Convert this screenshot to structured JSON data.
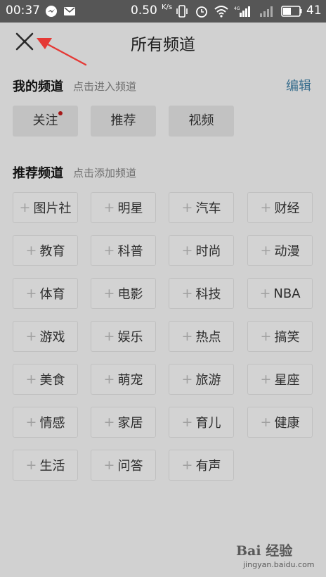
{
  "status_bar": {
    "time": "00:37",
    "network_speed": "0.50",
    "speed_unit": "K/s",
    "battery": "41",
    "icons": [
      "messenger-icon",
      "mail-icon",
      "vibrate-icon",
      "alarm-icon",
      "wifi-icon",
      "signal-4g-icon",
      "signal-icon",
      "battery-icon"
    ]
  },
  "header": {
    "title": "所有频道",
    "close_icon": "close-x-icon",
    "annotation": "red-arrow-pointer"
  },
  "my_channels": {
    "title": "我的频道",
    "hint": "点击进入频道",
    "edit_label": "编辑",
    "items": [
      {
        "label": "关注",
        "has_dot": true
      },
      {
        "label": "推荐",
        "has_dot": false
      },
      {
        "label": "视频",
        "has_dot": false
      }
    ]
  },
  "recommended_channels": {
    "title": "推荐频道",
    "hint": "点击添加频道",
    "plus": "+",
    "items": [
      "图片社",
      "明星",
      "汽车",
      "财经",
      "教育",
      "科普",
      "时尚",
      "动漫",
      "体育",
      "电影",
      "科技",
      "NBA",
      "游戏",
      "娱乐",
      "热点",
      "搞笑",
      "美食",
      "萌宠",
      "旅游",
      "星座",
      "情感",
      "家居",
      "育儿",
      "健康",
      "生活",
      "问答",
      "有声"
    ]
  },
  "watermark": {
    "brand": "Bai 经验",
    "url": "jingyan.baidu.com"
  },
  "colors": {
    "background": "#d1d1d1",
    "status_bar": "#565656",
    "edit_link": "#3a6f8e",
    "arrow": "#e53935",
    "notification_dot": "#a51818"
  }
}
